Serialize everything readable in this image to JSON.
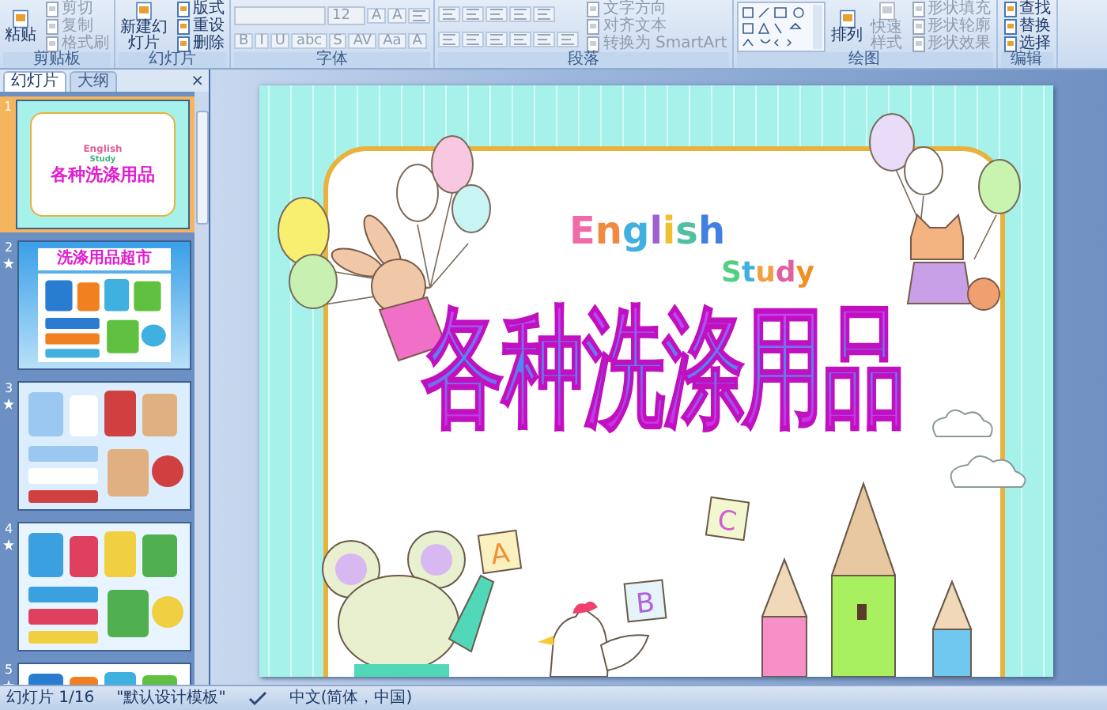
{
  "ribbon": {
    "groups": [
      {
        "label": "剪贴板",
        "columns": [
          [
            [
              {
                "kind": "large",
                "label": "粘贴",
                "disabled": false
              }
            ]
          ],
          [
            [
              {
                "kind": "small",
                "label": "剪切",
                "disabled": true
              }
            ],
            [
              {
                "kind": "small",
                "label": "复制",
                "disabled": true
              }
            ],
            [
              {
                "kind": "small",
                "label": "格式刷",
                "disabled": true
              }
            ]
          ]
        ]
      },
      {
        "label": "幻灯片",
        "columns": [
          [
            [
              {
                "kind": "large",
                "label": "新建幻灯片",
                "disabled": false
              }
            ]
          ],
          [
            [
              {
                "kind": "small",
                "label": "版式",
                "disabled": false
              }
            ],
            [
              {
                "kind": "small",
                "label": "重设",
                "disabled": false
              }
            ],
            [
              {
                "kind": "small",
                "label": "删除",
                "disabled": false
              }
            ]
          ]
        ]
      },
      {
        "label": "字体",
        "columns": [
          [
            [
              {
                "kind": "field",
                "disabled": true
              },
              {
                "kind": "field",
                "value": "12",
                "disabled": true
              },
              {
                "kind": "glyph",
                "label": "A",
                "disabled": true
              },
              {
                "kind": "glyph",
                "label": "A",
                "disabled": true
              },
              {
                "kind": "tool",
                "disabled": true
              }
            ],
            [
              {
                "kind": "glyph",
                "label": "B",
                "disabled": true
              },
              {
                "kind": "glyph",
                "label": "I",
                "disabled": true
              },
              {
                "kind": "glyph",
                "label": "U",
                "disabled": true
              },
              {
                "kind": "glyph",
                "label": "abc",
                "disabled": true
              },
              {
                "kind": "glyph",
                "label": "S",
                "disabled": true
              },
              {
                "kind": "glyph",
                "label": "AV",
                "disabled": true
              },
              {
                "kind": "glyph",
                "label": "Aa",
                "disabled": true
              },
              {
                "kind": "glyph",
                "label": "A",
                "disabled": true
              }
            ]
          ]
        ]
      },
      {
        "label": "段落",
        "columns": [
          [
            [
              {
                "kind": "tool",
                "disabled": true
              },
              {
                "kind": "tool",
                "disabled": true
              },
              {
                "kind": "tool",
                "disabled": true
              },
              {
                "kind": "tool",
                "disabled": true
              },
              {
                "kind": "tool",
                "disabled": true
              }
            ],
            [
              {
                "kind": "tool",
                "disabled": true
              },
              {
                "kind": "tool",
                "disabled": true
              },
              {
                "kind": "tool",
                "disabled": true
              },
              {
                "kind": "tool",
                "disabled": true
              },
              {
                "kind": "tool",
                "disabled": true
              },
              {
                "kind": "tool",
                "disabled": true
              }
            ]
          ],
          [
            [
              {
                "kind": "small",
                "label": "文字方向",
                "disabled": true
              }
            ],
            [
              {
                "kind": "small",
                "label": "对齐文本",
                "disabled": true
              }
            ],
            [
              {
                "kind": "small",
                "label": "转换为 SmartArt",
                "disabled": true
              }
            ]
          ]
        ]
      },
      {
        "label": "绘图",
        "columns": [
          [
            [
              {
                "kind": "gallery",
                "disabled": false
              }
            ]
          ],
          [
            [
              {
                "kind": "large",
                "label": "排列",
                "disabled": false
              }
            ]
          ],
          [
            [
              {
                "kind": "large",
                "label": "快速样式",
                "disabled": true
              }
            ]
          ],
          [
            [
              {
                "kind": "small",
                "label": "形状填充",
                "disabled": true
              }
            ],
            [
              {
                "kind": "small",
                "label": "形状轮廓",
                "disabled": true
              }
            ],
            [
              {
                "kind": "small",
                "label": "形状效果",
                "disabled": true
              }
            ]
          ]
        ]
      },
      {
        "label": "编辑",
        "columns": [
          [
            [
              {
                "kind": "small",
                "label": "查找",
                "disabled": false
              }
            ],
            [
              {
                "kind": "small",
                "label": "替换",
                "disabled": false
              }
            ],
            [
              {
                "kind": "small",
                "label": "选择",
                "disabled": false
              }
            ]
          ]
        ]
      }
    ]
  },
  "panel": {
    "tabs": [
      {
        "label": "幻灯片",
        "selected": true
      },
      {
        "label": "大纲",
        "selected": false
      }
    ],
    "close": "×",
    "slides": [
      {
        "number": "1",
        "selected": true,
        "animated": false,
        "kind": "title",
        "texts": [
          "English",
          "Study",
          "各种洗涤用品"
        ]
      },
      {
        "number": "2",
        "selected": false,
        "animated": true,
        "kind": "shop",
        "texts": [
          "洗涤用品超市"
        ]
      },
      {
        "number": "3",
        "selected": false,
        "animated": true,
        "kind": "picture"
      },
      {
        "number": "4",
        "selected": false,
        "animated": true,
        "kind": "picture"
      },
      {
        "number": "5",
        "selected": false,
        "animated": true,
        "kind": "picture"
      }
    ]
  },
  "slide": {
    "english": "English",
    "study": "Study",
    "title": "各种洗涤用品",
    "blocks": [
      "A",
      "B",
      "C"
    ]
  },
  "status_bar": [
    "幻灯片 1/16",
    "\"默认设计模板\"",
    "中文(简体，中国)"
  ]
}
